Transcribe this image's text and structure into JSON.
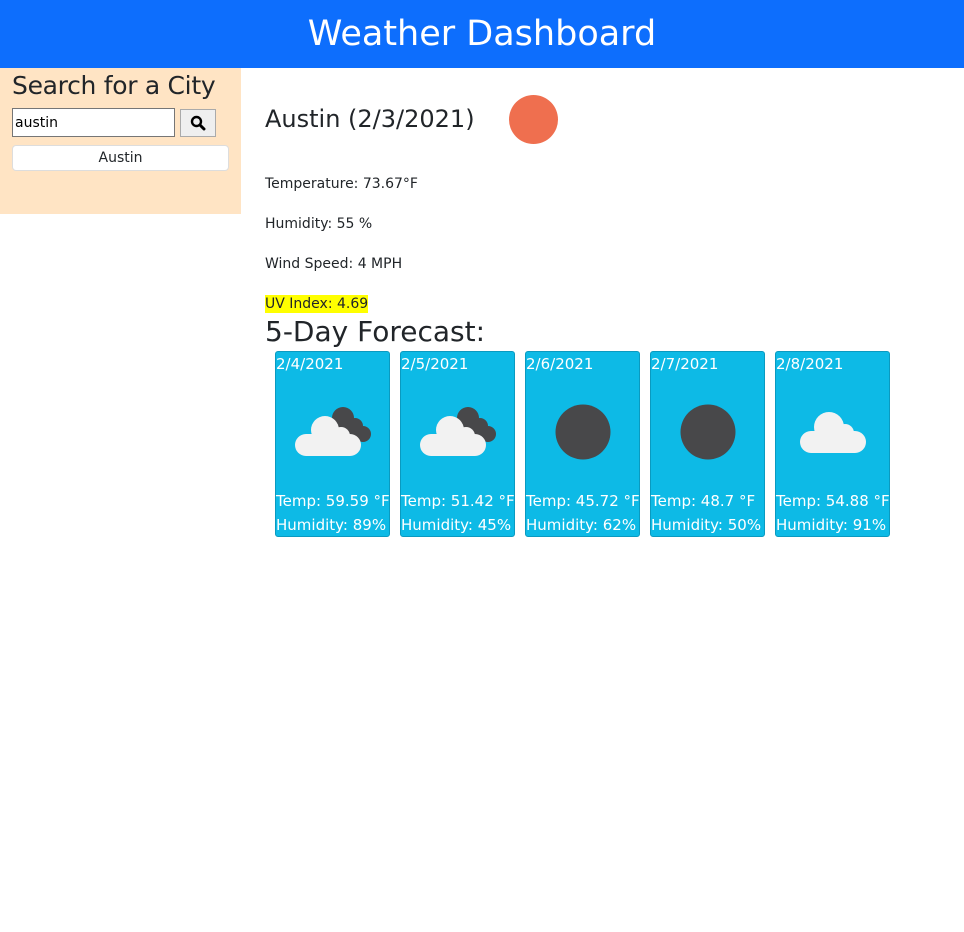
{
  "header": {
    "title": "Weather Dashboard"
  },
  "sidebar": {
    "title": "Search for a City",
    "search_value": "austin",
    "search_icon": "search-icon",
    "history": [
      {
        "label": "Austin"
      }
    ]
  },
  "current": {
    "title": "Austin (2/3/2021)",
    "icon": "clear-sun-icon",
    "icon_color": "#ef6f4f",
    "temperature": "Temperature: 73.67°F",
    "humidity": "Humidity: 55 %",
    "wind": "Wind Speed: 4 MPH",
    "uv": "UV Index: 4.69",
    "uv_color": "#ffff00"
  },
  "forecast": {
    "title": "5-Day Forecast:",
    "days": [
      {
        "date": "2/4/2021",
        "icon": "broken-clouds-icon",
        "temp": "Temp: 59.59 °F",
        "humidity": "Humidity: 89%"
      },
      {
        "date": "2/5/2021",
        "icon": "broken-clouds-icon",
        "temp": "Temp: 51.42 °F",
        "humidity": "Humidity: 45%"
      },
      {
        "date": "2/6/2021",
        "icon": "night-clear-icon",
        "temp": "Temp: 45.72 °F",
        "humidity": "Humidity: 62%"
      },
      {
        "date": "2/7/2021",
        "icon": "night-clear-icon",
        "temp": "Temp: 48.7 °F",
        "humidity": "Humidity: 50%"
      },
      {
        "date": "2/8/2021",
        "icon": "cloud-icon",
        "temp": "Temp: 54.88 °F",
        "humidity": "Humidity: 91%"
      }
    ],
    "card_color": "#0dbae6"
  }
}
